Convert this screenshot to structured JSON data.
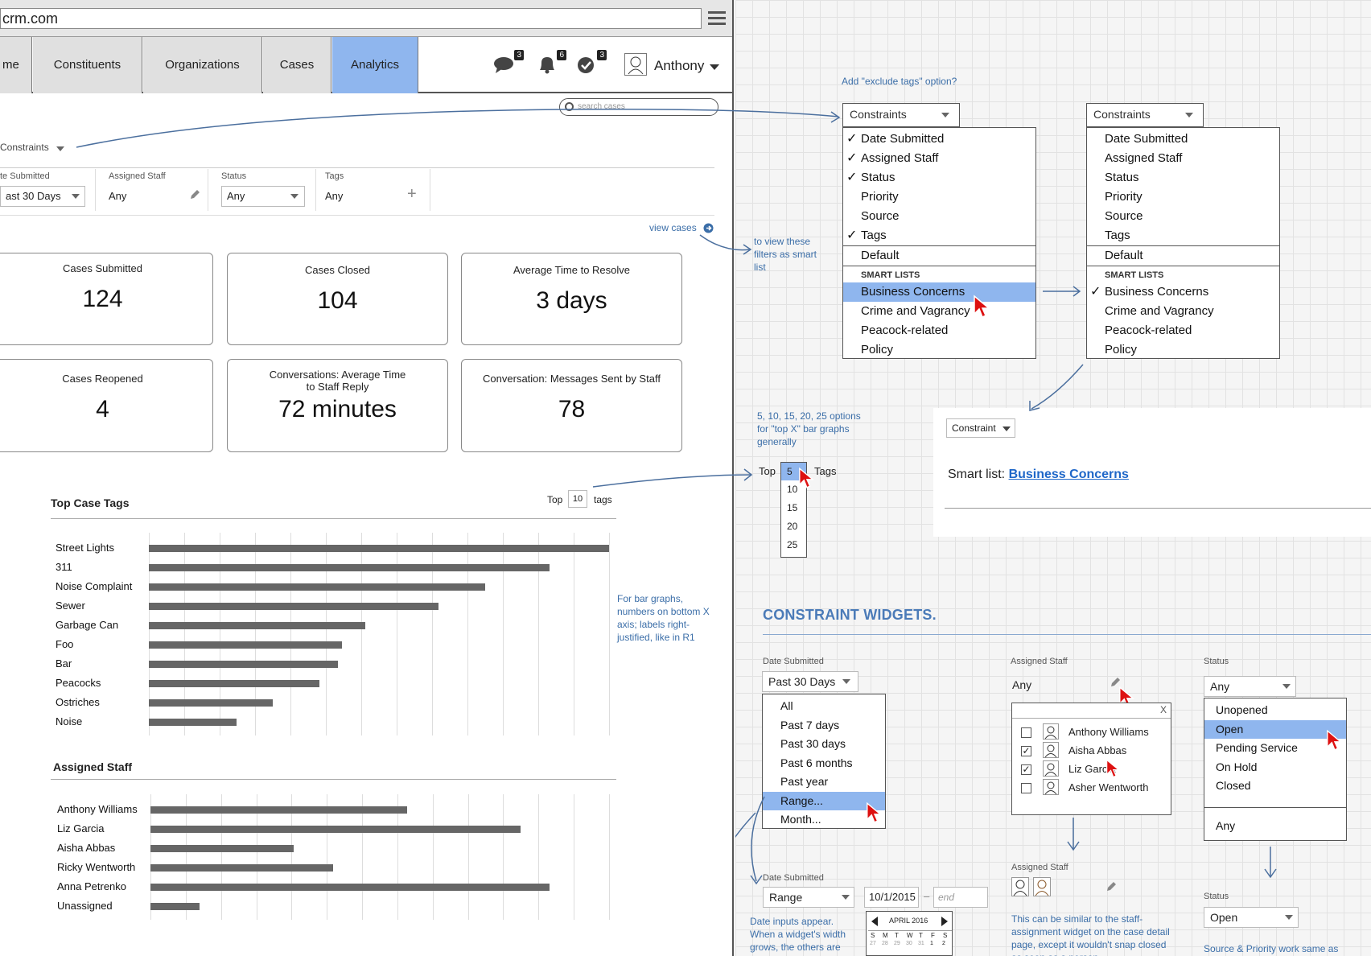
{
  "browser": {
    "url": "crm.com"
  },
  "nav": {
    "tabs": [
      {
        "label": "me"
      },
      {
        "label": "Constituents"
      },
      {
        "label": "Organizations"
      },
      {
        "label": "Cases"
      },
      {
        "label": "Analytics"
      }
    ],
    "badges": {
      "messages": "3",
      "notifications": "6",
      "tasks": "3"
    },
    "user": "Anthony"
  },
  "search": {
    "placeholder": "search cases"
  },
  "filters": {
    "constraints_label": "Constraints",
    "date_label": "te Submitted",
    "date_value": "ast 30 Days",
    "staff_label": "Assigned Staff",
    "staff_value": "Any",
    "status_label": "Status",
    "status_value": "Any",
    "tags_label": "Tags",
    "tags_value": "Any",
    "view_cases": "view cases"
  },
  "stats": [
    {
      "title": "Cases Submitted",
      "value": "124"
    },
    {
      "title": "Cases Closed",
      "value": "104"
    },
    {
      "title": "Average Time to Resolve",
      "value": "3 days"
    },
    {
      "title": "Cases Reopened",
      "value": "4"
    },
    {
      "title": "Conversations: Average Time to Staff Reply",
      "value": "72 minutes"
    },
    {
      "title": "Conversation: Messages Sent by Staff",
      "value": "78"
    }
  ],
  "chart_data": [
    {
      "type": "bar",
      "title": "Top Case Tags",
      "top_prefix": "Top",
      "top_value": "10",
      "top_suffix": "tags",
      "categories": [
        "Street Lights",
        "311",
        "Noise Complaint",
        "Sewer",
        "Garbage Can",
        "Foo",
        "Bar",
        "Peacocks",
        "Ostriches",
        "Noise"
      ],
      "values": [
        100,
        87,
        73,
        63,
        47,
        42,
        41,
        37,
        27,
        19
      ],
      "xlim": [
        0,
        100
      ],
      "grid": true
    },
    {
      "type": "bar",
      "title": "Assigned Staff",
      "categories": [
        "Anthony Williams",
        "Liz Garcia",
        "Aisha Abbas",
        "Ricky Wentworth",
        "Anna Petrenko",
        "Unassigned"
      ],
      "values": [
        52,
        75,
        29,
        37,
        81,
        10
      ],
      "xlim": [
        0,
        93
      ],
      "grid": true
    }
  ],
  "notes": {
    "bar_graphs": "For bar graphs, numbers on bottom X axis; labels right-justified, like in R1",
    "exclude_tags": "Add \"exclude tags\" option?",
    "view_smart": "to view these filters as smart list",
    "top_options": "5, 10, 15, 20, 25 options for \"top X\" bar graphs generally",
    "date_inputs": "Date inputs appear. When a widget's width grows, the others are",
    "staff_similar": "This can be similar to the staff-assignment widget on the case detail page, except it wouldn't snap closed as soon as a person",
    "source_priority": "Source & Priority work same as"
  },
  "constraints_menu_1": {
    "header": "Constraints",
    "items": [
      {
        "label": "Date Submitted",
        "checked": "✓"
      },
      {
        "label": "Assigned Staff",
        "checked": "✓"
      },
      {
        "label": "Status",
        "checked": "✓"
      },
      {
        "label": "Priority",
        "checked": ""
      },
      {
        "label": "Source",
        "checked": ""
      },
      {
        "label": "Tags",
        "checked": "✓"
      }
    ],
    "default": "Default",
    "smart_title": "SMART LISTS",
    "smart": [
      {
        "label": "Business Concerns",
        "checked": ""
      },
      {
        "label": "Crime and Vagrancy",
        "checked": ""
      },
      {
        "label": "Peacock-related",
        "checked": ""
      },
      {
        "label": "Policy",
        "checked": ""
      }
    ]
  },
  "constraints_menu_2": {
    "header": "Constraints",
    "items": [
      {
        "label": "Date Submitted",
        "checked": ""
      },
      {
        "label": "Assigned Staff",
        "checked": ""
      },
      {
        "label": "Status",
        "checked": ""
      },
      {
        "label": "Priority",
        "checked": ""
      },
      {
        "label": "Source",
        "checked": ""
      },
      {
        "label": "Tags",
        "checked": ""
      }
    ],
    "default": "Default",
    "smart_title": "SMART LISTS",
    "smart": [
      {
        "label": "Business Concerns",
        "checked": "✓"
      },
      {
        "label": "Crime and Vagrancy",
        "checked": ""
      },
      {
        "label": "Peacock-related",
        "checked": ""
      },
      {
        "label": "Policy",
        "checked": ""
      }
    ]
  },
  "smart_panel": {
    "constraint_label": "Constraint",
    "prefix": "Smart list: ",
    "link": "Business Concerns"
  },
  "top_picker": {
    "prefix": "Top",
    "suffix": "Tags",
    "options": [
      "5",
      "10",
      "15",
      "20",
      "25"
    ]
  },
  "widgets": {
    "heading": "CONSTRAINT WIDGETS.",
    "date": {
      "label": "Date Submitted",
      "value": "Past 30 Days",
      "options": [
        "All",
        "Past 7 days",
        "Past 30 days",
        "Past 6 months",
        "Past year",
        "Range...",
        "Month..."
      ]
    },
    "staff": {
      "label": "Assigned Staff",
      "value": "Any",
      "close": "X",
      "people": [
        {
          "name": "Anthony Williams",
          "checked": ""
        },
        {
          "name": "Aisha Abbas",
          "checked": "✓"
        },
        {
          "name": "Liz Garcia",
          "checked": "✓"
        },
        {
          "name": "Asher Wentworth",
          "checked": ""
        }
      ]
    },
    "status": {
      "label": "Status",
      "value": "Any",
      "options": [
        "Unopened",
        "Open",
        "Pending Service",
        "On Hold",
        "Closed"
      ],
      "any": "Any"
    },
    "date_range": {
      "label": "Date Submitted",
      "value": "Range",
      "start": "10/1/2015",
      "end_placeholder": "end",
      "dash": "–",
      "month": "APRIL 2016",
      "weekdays": [
        "S",
        "M",
        "T",
        "W",
        "T",
        "F",
        "S"
      ],
      "days": [
        "27",
        "28",
        "29",
        "30",
        "31",
        "1",
        "2"
      ]
    },
    "staff_result": {
      "label": "Assigned Staff"
    },
    "status_result": {
      "label": "Status",
      "value": "Open"
    }
  }
}
